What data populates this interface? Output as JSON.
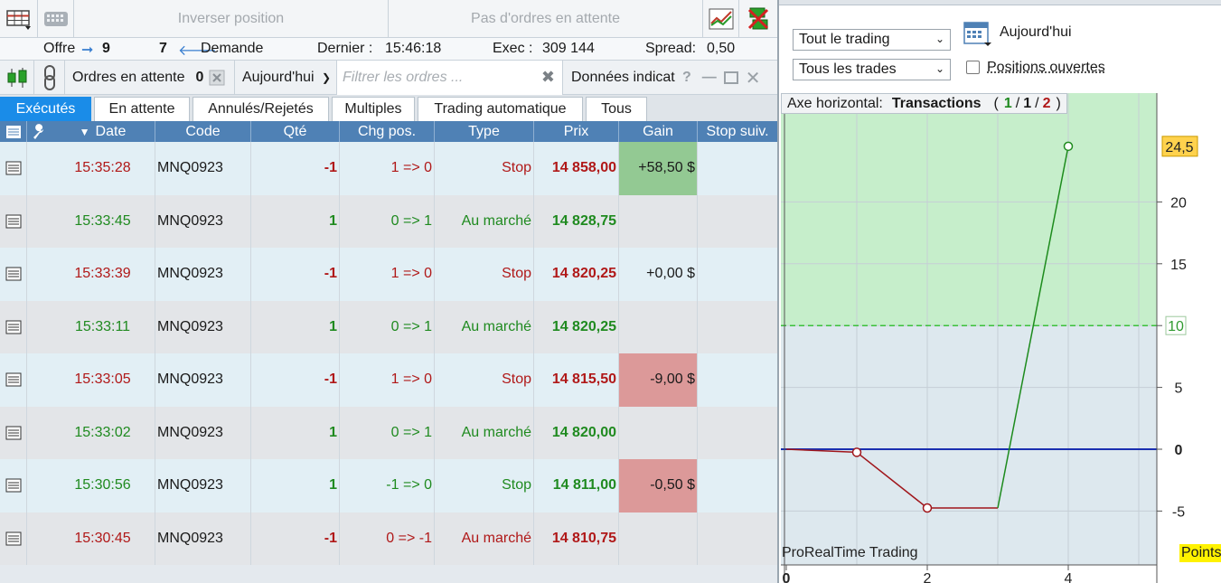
{
  "toolbar": {
    "reverse_position": "Inverser position",
    "no_pending_orders": "Pas d'ordres en attente"
  },
  "quote": {
    "offer_label": "Offre",
    "offer_value": "9",
    "demand_value": "7",
    "demand_label": "Demande",
    "last_label": "Dernier :",
    "last_value": "15:46:18",
    "exec_label": "Exec :",
    "exec_value": "309 144",
    "spread_label": "Spread:",
    "spread_value": "0,50"
  },
  "orders_bar": {
    "pending_label": "Ordres en attente",
    "pending_count": "0",
    "period": "Aujourd'hui",
    "filter_placeholder": "Filtrer les ordres ...",
    "indicator_data": "Données indicat",
    "help": "?"
  },
  "tabs": [
    "Exécutés",
    "En attente",
    "Annulés/Rejetés",
    "Multiples",
    "Trading automatique",
    "Tous"
  ],
  "table": {
    "headers": [
      "Date",
      "Code",
      "Qté",
      "Chg pos.",
      "Type",
      "Prix",
      "Gain",
      "Stop suiv."
    ],
    "rows": [
      {
        "date": "15:35:28",
        "code": "MNQ0923",
        "qty": "-1",
        "chg": "1 => 0",
        "type": "Stop",
        "price": "14 858,00",
        "gain": "+58,50 $",
        "gain_state": "positive",
        "side": "sell"
      },
      {
        "date": "15:33:45",
        "code": "MNQ0923",
        "qty": "1",
        "chg": "0 => 1",
        "type": "Au marché",
        "price": "14 828,75",
        "gain": "",
        "gain_state": "none",
        "side": "buy"
      },
      {
        "date": "15:33:39",
        "code": "MNQ0923",
        "qty": "-1",
        "chg": "1 => 0",
        "type": "Stop",
        "price": "14 820,25",
        "gain": "+0,00 $",
        "gain_state": "none",
        "side": "sell"
      },
      {
        "date": "15:33:11",
        "code": "MNQ0923",
        "qty": "1",
        "chg": "0 => 1",
        "type": "Au marché",
        "price": "14 820,25",
        "gain": "",
        "gain_state": "none",
        "side": "buy"
      },
      {
        "date": "15:33:05",
        "code": "MNQ0923",
        "qty": "-1",
        "chg": "1 => 0",
        "type": "Stop",
        "price": "14 815,50",
        "gain": "-9,00 $",
        "gain_state": "negative",
        "side": "sell"
      },
      {
        "date": "15:33:02",
        "code": "MNQ0923",
        "qty": "1",
        "chg": "0 => 1",
        "type": "Au marché",
        "price": "14 820,00",
        "gain": "",
        "gain_state": "none",
        "side": "buy"
      },
      {
        "date": "15:30:56",
        "code": "MNQ0923",
        "qty": "1",
        "chg": "-1 => 0",
        "type": "Stop",
        "price": "14 811,00",
        "gain": "-0,50 $",
        "gain_state": "negative",
        "side": "buy"
      },
      {
        "date": "15:30:45",
        "code": "MNQ0923",
        "qty": "-1",
        "chg": "0 => -1",
        "type": "Au marché",
        "price": "14 810,75",
        "gain": "",
        "gain_state": "none",
        "side": "sell"
      }
    ]
  },
  "right": {
    "select_trading": "Tout le trading",
    "select_trades": "Tous les trades",
    "date_label": "Aujourd'hui",
    "open_positions": "Positions ouvertes",
    "axis_label": "Axe horizontal:",
    "axis_value": "Transactions",
    "pager_current": "1",
    "pager_sep": "/",
    "pager_total_a": "1",
    "pager_total_b": "2",
    "watermark": "ProRealTime Trading",
    "points_label": "Points"
  },
  "colors": {
    "tab_active": "#1a8ce8",
    "header_blue": "#4f81b5",
    "sell_red": "#b01818",
    "buy_green": "#1f8a1f",
    "gain_positive": "#93c993",
    "gain_negative": "#dc9999",
    "zone_green": "#c6eecb",
    "line_red": "#a0161b",
    "line_green": "#1d8b1d",
    "zero_line": "#1a2fb0"
  },
  "chart_data": {
    "type": "line",
    "title": "",
    "xlabel": "",
    "ylabel": "Points",
    "x_ticks": [
      "0",
      "2",
      "4"
    ],
    "y_ticks": [
      "-5",
      "0",
      "5",
      "10",
      "15",
      "20"
    ],
    "ylim": [
      -7.5,
      29
    ],
    "xlim": [
      0,
      5.3
    ],
    "threshold": 10,
    "threshold_label": "10",
    "last_value_label": "24,5",
    "series": [
      {
        "values": [
          {
            "x": 0,
            "y": 0
          },
          {
            "x": 1,
            "y": -0.25
          },
          {
            "x": 2,
            "y": -4.75
          },
          {
            "x": 3,
            "y": -4.75
          },
          {
            "x": 4,
            "y": 24.5
          }
        ]
      }
    ],
    "markers": [
      {
        "x": 1,
        "y": -0.25,
        "kind": "loss"
      },
      {
        "x": 2,
        "y": -4.75,
        "kind": "loss"
      },
      {
        "x": 4,
        "y": 24.5,
        "kind": "gain"
      }
    ],
    "grid": true
  }
}
